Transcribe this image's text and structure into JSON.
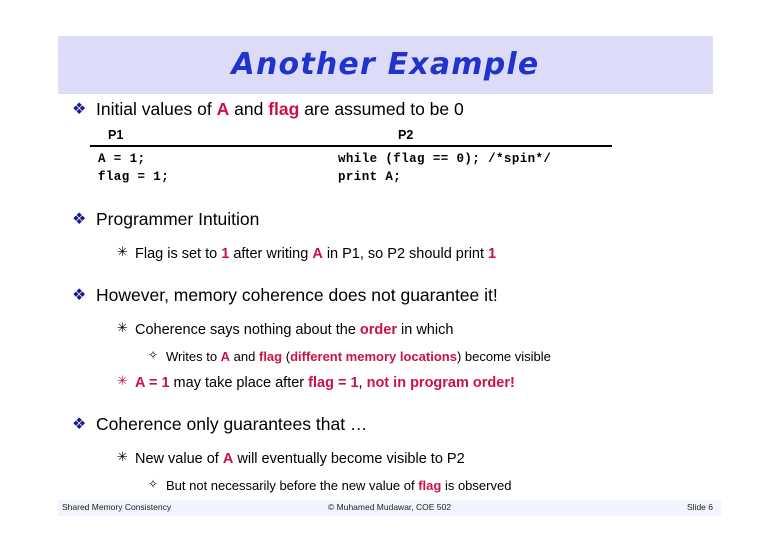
{
  "slide": {
    "title": "Another Example",
    "title_banner_color": "#dcdcf8",
    "title_color": "#2233cc",
    "accent_color": "#cc1144"
  },
  "bullets": {
    "b1_glyph": "❖",
    "b2_glyph": "✳",
    "b3_glyph": "✧"
  },
  "body": {
    "line1": {
      "pre": "Initial values of ",
      "hl1": "A",
      "mid": " and ",
      "hl2": "flag",
      "post": " are assumed to be 0"
    },
    "code": {
      "header_p1": "P1",
      "header_p2": "P2",
      "rows": [
        {
          "p1": "A = 1;",
          "p2": "while (flag == 0); /*spin*/"
        },
        {
          "p1": "flag = 1;",
          "p2": "print A;"
        }
      ]
    },
    "intuition_heading": "Programmer Intuition",
    "intuition_sub": {
      "pre": "Flag is set to ",
      "hl1": "1",
      "mid": " after writing ",
      "hl2": "A",
      "post": " in P1, so P2 should print ",
      "hl3": "1"
    },
    "however_heading": "However, memory coherence does not guarantee it!",
    "however_sub": {
      "pre": "Coherence says nothing about the ",
      "hl1": "order",
      "post": " in which"
    },
    "however_sub_sub": {
      "pre": "Writes to ",
      "hl1": "A",
      "mid": " and ",
      "hl2": "flag",
      "paren_open": " (",
      "hl3": "different memory locations",
      "post": ") become visible"
    },
    "reorder_line": {
      "hl1": "A = 1",
      "mid": " may take place after ",
      "hl2": "flag = 1",
      "comma": ", ",
      "hl3": "not in program order!"
    },
    "guarantee_heading": "Coherence only guarantees that …",
    "guarantee_sub": {
      "pre": "New value of ",
      "hl1": "A",
      "post": " will eventually become visible to P2"
    },
    "guarantee_sub_sub": {
      "pre": "But not necessarily before the new value of ",
      "hl1": "flag",
      "post": " is observed"
    }
  },
  "footer": {
    "left": "Shared Memory Consistency",
    "center": "© Muhamed Mudawar, COE 502",
    "right": "Slide 6"
  }
}
